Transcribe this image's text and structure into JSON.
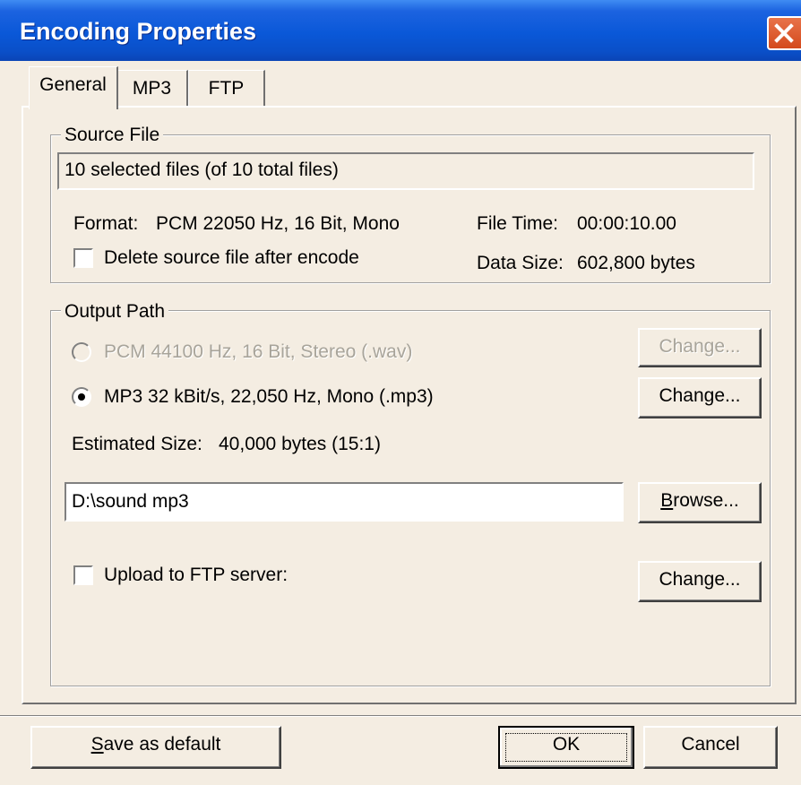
{
  "window": {
    "title": "Encoding Properties"
  },
  "tabs": [
    {
      "label": "General"
    },
    {
      "label": "MP3"
    },
    {
      "label": "FTP"
    }
  ],
  "source_file": {
    "group_title": "Source File",
    "selection_text": "10 selected files (of 10 total files)",
    "format_label": "Format:",
    "format_value": "PCM 22050 Hz, 16 Bit, Mono",
    "file_time_label": "File Time:",
    "file_time_value": "00:00:10.00",
    "data_size_label": "Data Size:",
    "data_size_value": "602,800 bytes",
    "delete_checkbox_label": "Delete source file after encode",
    "delete_checked": false
  },
  "output_path": {
    "group_title": "Output Path",
    "option_pcm": "PCM 44100 Hz, 16 Bit, Stereo (.wav)",
    "option_mp3": "MP3 32 kBit/s, 22,050 Hz, Mono (.mp3)",
    "selected_option": "mp3",
    "change_label": "Change...",
    "estimated_size_label": "Estimated Size:",
    "estimated_size_value": "40,000 bytes (15:1)",
    "path_value": "D:\\sound mp3",
    "browse_label_mnemonic": "B",
    "browse_label_rest": "rowse...",
    "upload_checkbox_label": "Upload to FTP server:",
    "upload_checked": false
  },
  "footer": {
    "save_default_mnemonic": "S",
    "save_default_rest": "ave as default",
    "ok_label": "OK",
    "cancel_label": "Cancel"
  }
}
